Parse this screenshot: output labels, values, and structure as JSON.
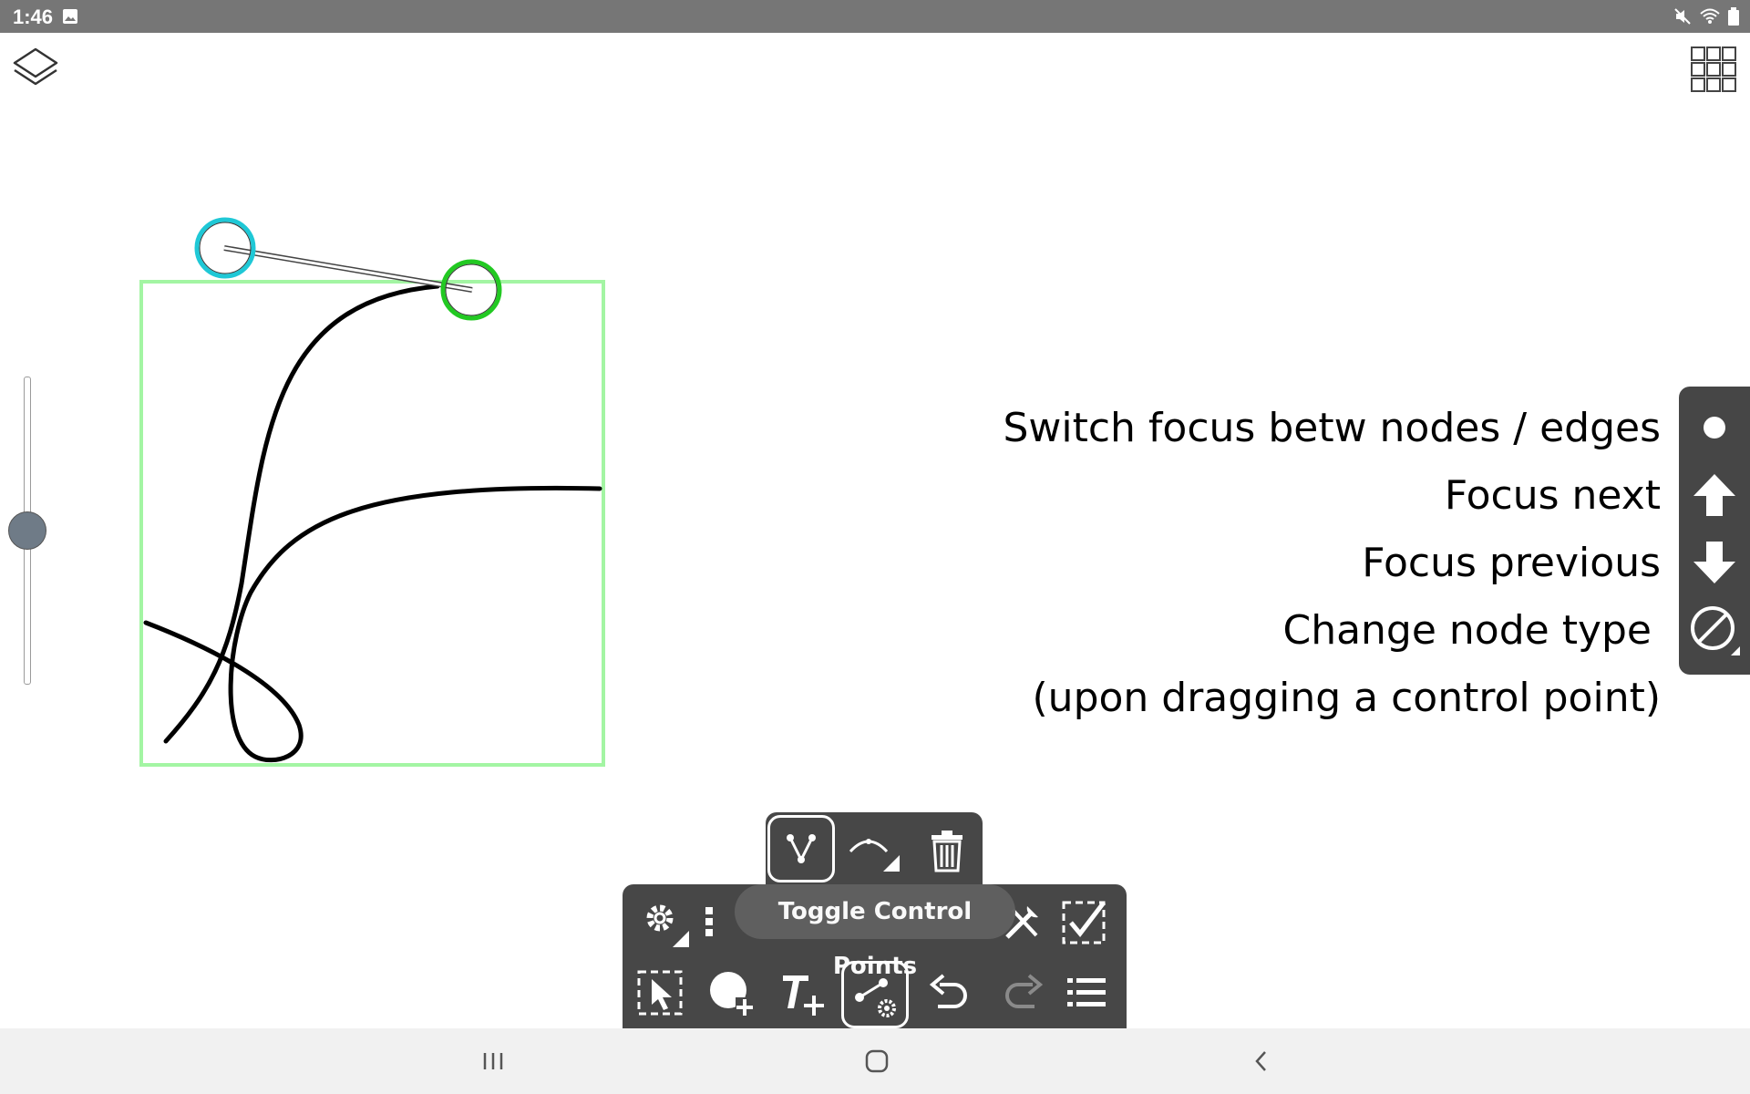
{
  "status_bar": {
    "time": "1:46",
    "icons": [
      "gallery-icon",
      "mute-icon",
      "wifi-icon",
      "battery-icon"
    ]
  },
  "top_left": {
    "icon": "layers-icon"
  },
  "top_right": {
    "icon": "grid-icon"
  },
  "zoom_slider": {
    "level": 0.5
  },
  "hints": {
    "switch_focus": "Switch focus betw nodes / edges",
    "focus_next": "Focus next",
    "focus_previous": "Focus previous",
    "change_node_type": "Change node type",
    "change_node_type_note": "(upon dragging a control point)"
  },
  "right_panel": {
    "buttons": [
      "dot-icon",
      "arrow-up-icon",
      "arrow-down-icon",
      "node-type-icon"
    ]
  },
  "node_popup": {
    "buttons": [
      "node-edit-icon",
      "curve-edit-icon",
      "trash-icon"
    ]
  },
  "toolbar": {
    "tooltip": "Toggle Control Points",
    "row1": [
      "settings-icon",
      "more-icon",
      "tools-icon",
      "select-done-icon"
    ],
    "row2": [
      "select-icon",
      "add-node-icon",
      "add-text-icon",
      "control-points-icon",
      "undo-icon",
      "redo-icon",
      "list-icon"
    ]
  },
  "colors": {
    "selection_box": "#a3f5a3",
    "control_start": "#1fc8d6",
    "control_end": "#22c922",
    "panel_bg": "#474747"
  },
  "nav_bar": {
    "buttons": [
      "recents-icon",
      "home-icon",
      "back-icon"
    ]
  }
}
